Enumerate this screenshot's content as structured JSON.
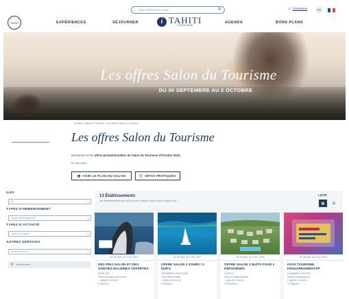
{
  "header": {
    "search_placeholder": "Que recherchez-vous ?",
    "login_label": "Connexion",
    "lang_label": "FR",
    "logo_label": "TAHITI",
    "brand_name": "TAHITI",
    "brand_sub": "TOURISME",
    "nav": [
      {
        "label": "EXPÉRIENCES"
      },
      {
        "label": "SÉJOURNER"
      },
      {
        "label": "AGENDA"
      },
      {
        "label": "BONS PLANS"
      }
    ]
  },
  "hero": {
    "title": "Les offres Salon du Tourisme",
    "subtitle": "DU 30 SEPTEMBRE AU 2 OCTOBRE"
  },
  "breadcrumb": "Accueil  >  Salon du Tourisme  >  Les offres Salon du Tourisme",
  "promo": {
    "title": "Les offres Salon du Tourisme",
    "desc_prefix": "Découvrez ici les ",
    "desc_bold": "offres promotionnelles du Salon du Tourisme d'Octobre 2022.",
    "more": "En voir plus !",
    "btn_plan": "VOIR LE PLAN DU SALON",
    "btn_info": "INFOS PRATIQUES"
  },
  "sidebar": {
    "iles_heading": "ILES",
    "iles_value": "Île",
    "hebergement_heading": "TYPES D'HÉBERGEMENT",
    "hebergement_value": "Types d'hébergement",
    "activite_heading": "TYPES D'ACTIVITÉ",
    "activite_value": "Types d'activité",
    "services_heading": "AUTRES SERVICES",
    "services_value": "Autres services",
    "search_label": "Rechercher"
  },
  "results": {
    "count": "13 Établissements",
    "note": "Les établissements dont la fiche peut s'afficher dans la vue en grille sont :",
    "view_label": "LISTE",
    "cards": [
      {
        "title": "DES PRIX SALON ET DES SORTIES BALEINES OFFERTES",
        "date": "Du 30 sept. au 2 oct. 2022",
        "org": "MOPI LEE",
        "line1": "Sortie de baleine de Moorea",
        "line2": "+ (689) 87 00 00 00",
        "loc": "Moorea"
      },
      {
        "title": "OFFRE SALON 3 JOURS / 2 NUITS",
        "date": "Du 30 sept. au 2 oct. 2022",
        "org": "CROISIÈRE EN VOILIER",
        "line1": "Faa'a Tahiti Charter",
        "line2": "+ (689) 40 00 00 00",
        "loc": "Raiatea"
      },
      {
        "title": "OFFRE SALON 3 NUITS POUR 2 PERSONNES",
        "date": "Du 30 sept. au 2 oct. 2022",
        "org": "HOTELS",
        "line1": "Hôtel Le Maitai Rauhiva",
        "line2": "+ (689) 40 00 00 00",
        "loc": "Bora Bora"
      },
      {
        "title": "PASS TOURISME FENUARESIDENT.PF",
        "date": "Du 30 sept. au 2 oct. 2022",
        "org": "CHAMBRE D'HÔTES",
        "line1": "Pass Fenuaresident.pf",
        "line2": "+ (689) 87 00 00 00",
        "loc": "Papeete"
      }
    ]
  },
  "colors": {
    "navy": "#1d3a5c",
    "accent": "#6b8fb5",
    "flag_blue": "#0055a4",
    "flag_red": "#ef4135"
  }
}
